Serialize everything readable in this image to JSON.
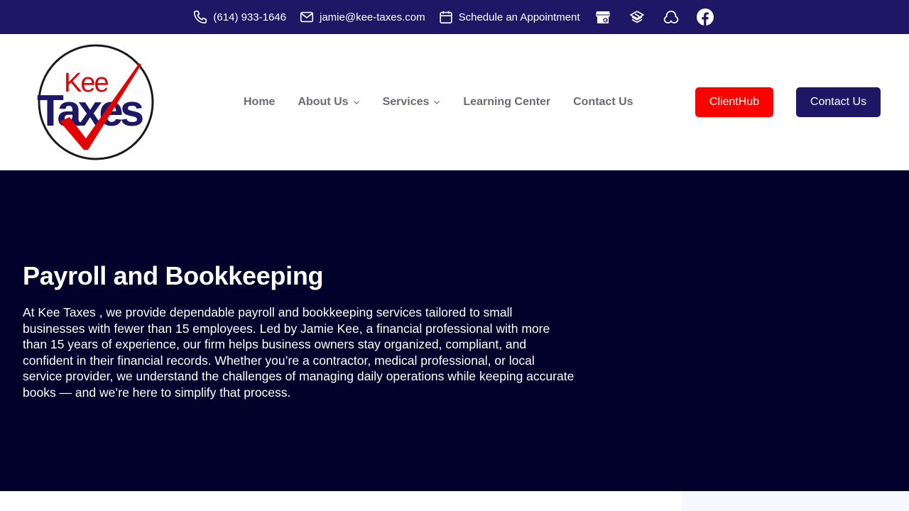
{
  "topbar": {
    "phone": "(614) 933-1646",
    "email": "jamie@kee-taxes.com",
    "appointment": "Schedule an Appointment",
    "social_icons": [
      "google-business-icon",
      "taxbuzz-icon",
      "nextdoor-icon",
      "facebook-icon"
    ]
  },
  "header": {
    "logo": {
      "line1": "Kee",
      "line2": "Taxes"
    },
    "nav": [
      {
        "label": "Home",
        "dropdown": false
      },
      {
        "label": "About Us",
        "dropdown": true
      },
      {
        "label": "Services",
        "dropdown": true
      },
      {
        "label": "Learning Center",
        "dropdown": false
      },
      {
        "label": "Contact Us",
        "dropdown": false
      }
    ],
    "clienthub_label": "ClientHub",
    "contact_label": "Contact Us"
  },
  "hero": {
    "title": "Payroll and Bookkeeping",
    "text": "At Kee Taxes , we provide dependable payroll and bookkeeping services tailored to small businesses with fewer than 15 employees. Led by Jamie Kee, a financial professional with more than 15 years of experience, our firm helps business owners stay organized, compliant, and confident in their financial records. Whether you’re a contractor, medical professional, or local service provider, we understand the challenges of managing daily operations while keeping accurate books — and we’re here to simplify that process."
  },
  "colors": {
    "topbar": "#1e1766",
    "hero": "#02012b",
    "accent_red": "#ff0000",
    "nav_text": "#6b6b74"
  }
}
